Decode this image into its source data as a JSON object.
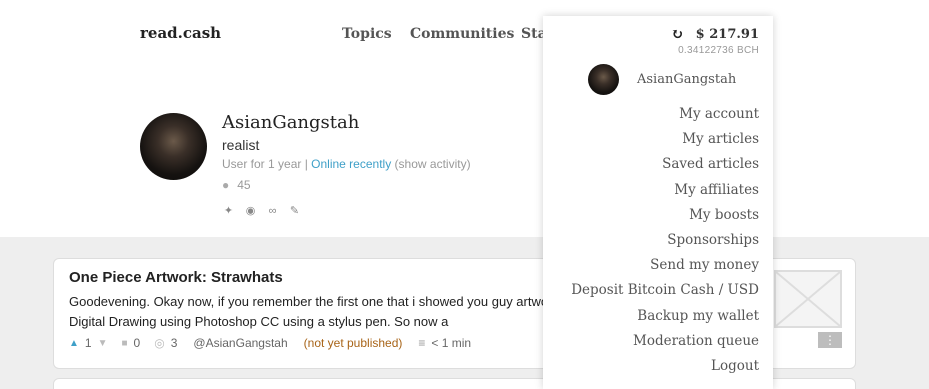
{
  "header": {
    "logo": "read.cash",
    "nav": [
      "Topics",
      "Communities",
      "Stat"
    ]
  },
  "profile": {
    "name": "AsianGangstah",
    "tagline": "realist",
    "meta_prefix": "User for 1 year | ",
    "online": "Online recently",
    "show_activity": "(show activity)",
    "followers": "45"
  },
  "article": {
    "title": "One Piece Artwork: Strawhats",
    "excerpt": "Goodevening. Okay now, if you remember the first one that i showed you guy artwork in a Digital Drawing using Photoshop CC using a stylus pen. So now a",
    "likes": "1",
    "comments": "0",
    "views": "3",
    "author": "@AsianGangstah",
    "status": "(not yet published)",
    "read_time": "< 1 min",
    "more_label": "⋮"
  },
  "dropdown": {
    "balance_usd": "$ 217.91",
    "balance_bch": "0.34122736 BCH",
    "username": "AsianGangstah",
    "menu": [
      "My account",
      "My articles",
      "Saved articles",
      "My affiliates",
      "My boosts",
      "Sponsorships",
      "Send my money",
      "Deposit Bitcoin Cash / USD",
      "Backup my wallet",
      "Moderation queue",
      "Logout"
    ]
  },
  "icons": {
    "refresh": "↻",
    "user": "●",
    "twitter": "✦",
    "reddit": "◉",
    "link": "∞",
    "pencil": "✎",
    "thumb_up": "▲",
    "thumb_down": "▼",
    "comment": "■",
    "eye": "◎",
    "read": "≡"
  }
}
